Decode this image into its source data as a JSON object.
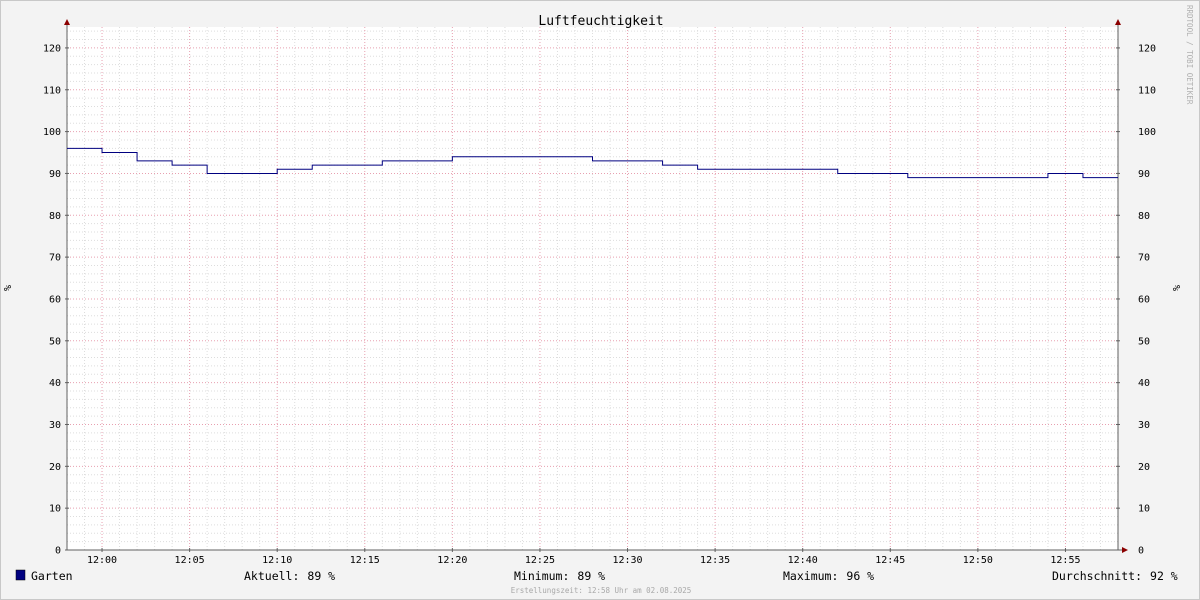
{
  "chart_data": {
    "type": "line",
    "title": "Luftfeuchtigkeit",
    "ylabel": "%",
    "ylim": [
      0,
      125
    ],
    "yticks": [
      0,
      10,
      20,
      30,
      40,
      50,
      60,
      70,
      80,
      90,
      100,
      110,
      120
    ],
    "xlim": [
      "11:58",
      "12:58"
    ],
    "xticks": [
      "12:00",
      "12:05",
      "12:10",
      "12:15",
      "12:20",
      "12:25",
      "12:30",
      "12:35",
      "12:40",
      "12:45",
      "12:50",
      "12:55"
    ],
    "grid": true,
    "series": [
      {
        "name": "Garten",
        "color": "#000080",
        "points": [
          {
            "t": "11:58",
            "v": 96
          },
          {
            "t": "12:00",
            "v": 95
          },
          {
            "t": "12:02",
            "v": 93
          },
          {
            "t": "12:04",
            "v": 92
          },
          {
            "t": "12:06",
            "v": 90
          },
          {
            "t": "12:08",
            "v": 90
          },
          {
            "t": "12:10",
            "v": 91
          },
          {
            "t": "12:12",
            "v": 92
          },
          {
            "t": "12:14",
            "v": 92
          },
          {
            "t": "12:16",
            "v": 93
          },
          {
            "t": "12:18",
            "v": 93
          },
          {
            "t": "12:20",
            "v": 94
          },
          {
            "t": "12:22",
            "v": 94
          },
          {
            "t": "12:24",
            "v": 94
          },
          {
            "t": "12:26",
            "v": 94
          },
          {
            "t": "12:28",
            "v": 93
          },
          {
            "t": "12:30",
            "v": 93
          },
          {
            "t": "12:32",
            "v": 92
          },
          {
            "t": "12:34",
            "v": 91
          },
          {
            "t": "12:36",
            "v": 91
          },
          {
            "t": "12:38",
            "v": 91
          },
          {
            "t": "12:40",
            "v": 91
          },
          {
            "t": "12:42",
            "v": 90
          },
          {
            "t": "12:44",
            "v": 90
          },
          {
            "t": "12:46",
            "v": 89
          },
          {
            "t": "12:48",
            "v": 89
          },
          {
            "t": "12:50",
            "v": 89
          },
          {
            "t": "12:52",
            "v": 89
          },
          {
            "t": "12:54",
            "v": 90
          },
          {
            "t": "12:56",
            "v": 89
          }
        ]
      }
    ],
    "legend": {
      "position": "bottom",
      "series_label": "Garten",
      "stats": [
        {
          "label": "Aktuell:",
          "value": "89 %"
        },
        {
          "label": "Minimum:",
          "value": "89 %"
        },
        {
          "label": "Maximum:",
          "value": "96 %"
        },
        {
          "label": "Durchschnitt:",
          "value": "92 %"
        }
      ]
    },
    "watermark": "RRDTOOL / TOBI OETIKER",
    "footer": "Erstellungszeit: 12:58 Uhr am 02.08.2025"
  },
  "colors": {
    "background": "#f3f3f3",
    "canvas": "#ffffff",
    "grid_minor": "#dddddd",
    "grid_major": "#e8a0b0",
    "axis": "#606060",
    "arrow": "#8b0000",
    "series": "#000080"
  }
}
